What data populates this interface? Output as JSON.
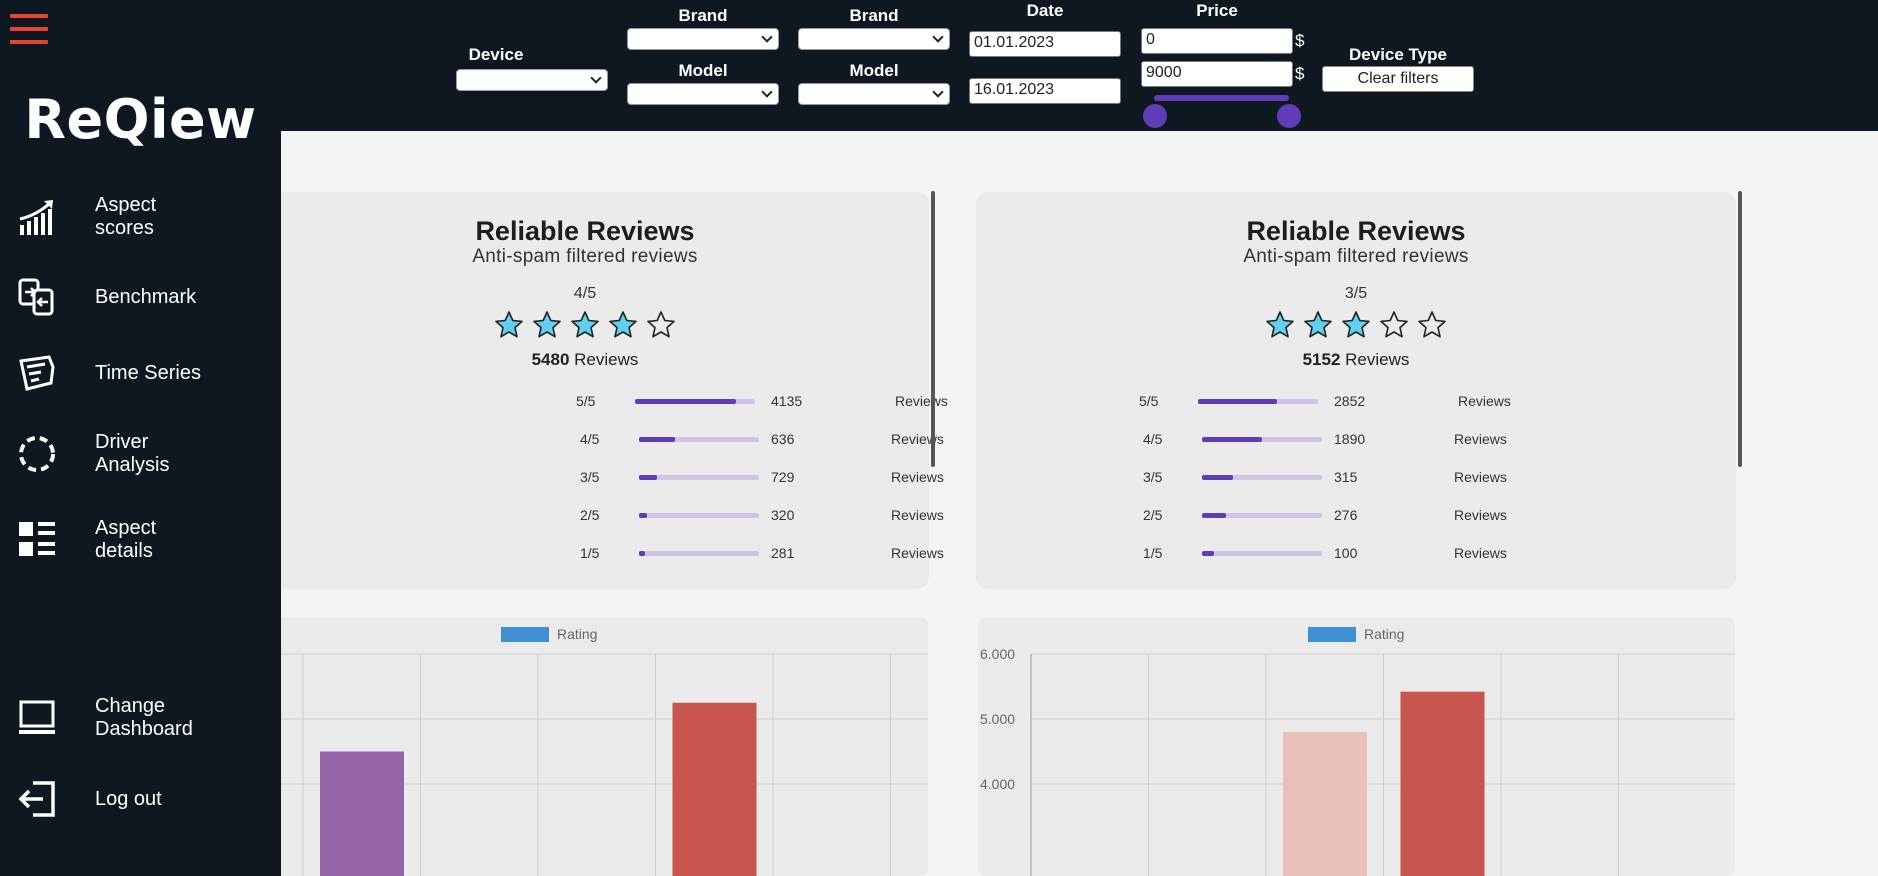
{
  "app": {
    "title": "ReQiew"
  },
  "sidebar": {
    "items": [
      {
        "label_line1": "Aspect",
        "label_line2": "scores",
        "icon": "chart-growth-icon"
      },
      {
        "label_line1": "Benchmark",
        "label_line2": "",
        "icon": "compare-files-icon"
      },
      {
        "label_line1": "Time Series",
        "label_line2": "",
        "icon": "time-series-icon"
      },
      {
        "label_line1": "Driver",
        "label_line2": "Analysis",
        "icon": "dashed-circle-icon"
      },
      {
        "label_line1": "Aspect",
        "label_line2": "details",
        "icon": "details-grid-icon"
      },
      {
        "label_line1": "Change",
        "label_line2": "Dashboard",
        "icon": "monitor-icon"
      },
      {
        "label_line1": "Log out",
        "label_line2": "",
        "icon": "logout-icon"
      }
    ]
  },
  "filters": {
    "device_label": "Device",
    "brand1_label": "Brand",
    "model1_label": "Model",
    "brand2_label": "Brand",
    "model2_label": "Model",
    "date_label": "Date",
    "date_from": "01.01.2023",
    "date_to": "16.01.2023",
    "price_label": "Price",
    "price_min": "0",
    "price_max": "9000",
    "currency": "$",
    "device_type_label": "Device Type",
    "clear_label": "Clear filters"
  },
  "cards": [
    {
      "title": "Reliable Reviews",
      "subtitle": "Anti-spam filtered reviews",
      "score": "4/5",
      "filled_stars": 4,
      "total": "5480",
      "total_suffix": "Reviews",
      "rows": [
        {
          "label": "5/5",
          "count": "4135",
          "word": "Reviews",
          "fraction": 0.84
        },
        {
          "label": "4/5",
          "count": "636",
          "word": "Reviews",
          "fraction": 0.3
        },
        {
          "label": "3/5",
          "count": "729",
          "word": "Reviews",
          "fraction": 0.15
        },
        {
          "label": "2/5",
          "count": "320",
          "word": "Reviews",
          "fraction": 0.07
        },
        {
          "label": "1/5",
          "count": "281",
          "word": "Reviews",
          "fraction": 0.05
        }
      ]
    },
    {
      "title": "Reliable Reviews",
      "subtitle": "Anti-spam filtered reviews",
      "score": "3/5",
      "filled_stars": 3,
      "total": "5152",
      "total_suffix": "Reviews",
      "rows": [
        {
          "label": "5/5",
          "count": "2852",
          "word": "Reviews",
          "fraction": 0.66
        },
        {
          "label": "4/5",
          "count": "1890",
          "word": "Reviews",
          "fraction": 0.5
        },
        {
          "label": "3/5",
          "count": "315",
          "word": "Reviews",
          "fraction": 0.26
        },
        {
          "label": "2/5",
          "count": "276",
          "word": "Reviews",
          "fraction": 0.2
        },
        {
          "label": "1/5",
          "count": "100",
          "word": "Reviews",
          "fraction": 0.1
        }
      ]
    }
  ],
  "chart_data": [
    {
      "type": "bar",
      "legend": "Rating",
      "title": "",
      "xlabel": "",
      "ylabel": "",
      "ylim": [
        4.0,
        6.0
      ],
      "yticks": [],
      "grid": true,
      "bars": [
        {
          "slot": 1,
          "value": 4.5,
          "color": "#9563a8"
        },
        {
          "slot": 4,
          "value": 5.25,
          "color": "#c9564e"
        }
      ]
    },
    {
      "type": "bar",
      "legend": "Rating",
      "title": "",
      "xlabel": "",
      "ylabel": "",
      "ylim": [
        4.0,
        6.0
      ],
      "yticks": [
        "6.000",
        "5.000",
        "4.000"
      ],
      "grid": true,
      "bars": [
        {
          "slot": 3,
          "value": 4.8,
          "color": "#e8c2b8"
        },
        {
          "slot": 4,
          "value": 5.42,
          "color": "#c9564e"
        }
      ]
    }
  ],
  "colors": {
    "accent": "#5e3cba",
    "sidebar_bg": "#0f1821",
    "hamburger": "#e8432c",
    "star_fill": "#5fd0f0"
  }
}
